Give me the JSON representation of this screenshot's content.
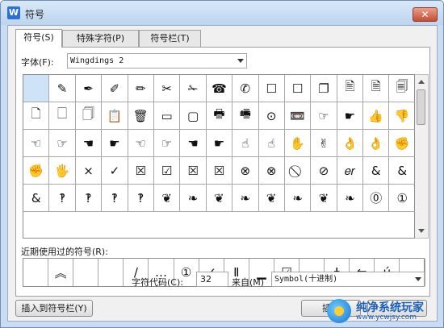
{
  "window": {
    "title": "符号",
    "app_icon": "W",
    "close": "✕"
  },
  "tabs": [
    {
      "label": "符号(S)"
    },
    {
      "label": "特殊字符(P)"
    },
    {
      "label": "符号栏(T)"
    }
  ],
  "font": {
    "label": "字体(F):",
    "value": "Wingdings 2"
  },
  "symbols": [
    "",
    "✎",
    "✒",
    "✐",
    "✏",
    "✂",
    "✁",
    "☎",
    "✆",
    "☐",
    "☐",
    "❐",
    "🖹",
    "🗎",
    "🗐",
    "🗋",
    "🗌",
    "🗍",
    "📋",
    "🗑",
    "▭",
    "▢",
    "🖶",
    "🖷",
    "⊙",
    "📼",
    "☞",
    "☛",
    "👍",
    "👎",
    "☜",
    "☞",
    "☚",
    "☛",
    "☜",
    "☞",
    "☚",
    "☛",
    "☝",
    "☝",
    "✋",
    "✌",
    "👌",
    "👌",
    "✊",
    "✊",
    "🖐",
    "×",
    "✓",
    "☒",
    "☑",
    "☒",
    "☒",
    "⊗",
    "⊗",
    "⃠",
    "⊘",
    "𝑒𝑟",
    "&",
    "&",
    "&",
    "‽",
    "‽",
    "‽",
    "‽",
    "❦",
    "❧",
    "❦",
    "❧",
    "❦",
    "❧",
    "❦",
    "❧",
    "⓪",
    "①"
  ],
  "recent": {
    "label": "近期使用过的符号(R):",
    "items": [
      "",
      "︽",
      "",
      "",
      "/",
      "…",
      "①",
      "✓",
      "Ⅱ",
      "▁",
      "☑",
      "",
      "ǂ",
      "⇋",
      "ú",
      ""
    ]
  },
  "code": {
    "label": "字符代码(C):",
    "value": "32",
    "from_label": "来自(M)",
    "from_value": "Symbol(十进制)"
  },
  "buttons": {
    "insert_bar": "插入到符号栏(Y)",
    "insert": "插入",
    "cancel": ""
  },
  "watermark": {
    "line1": "纯净系统玩家",
    "line2": "www.ycwjsy.com"
  }
}
